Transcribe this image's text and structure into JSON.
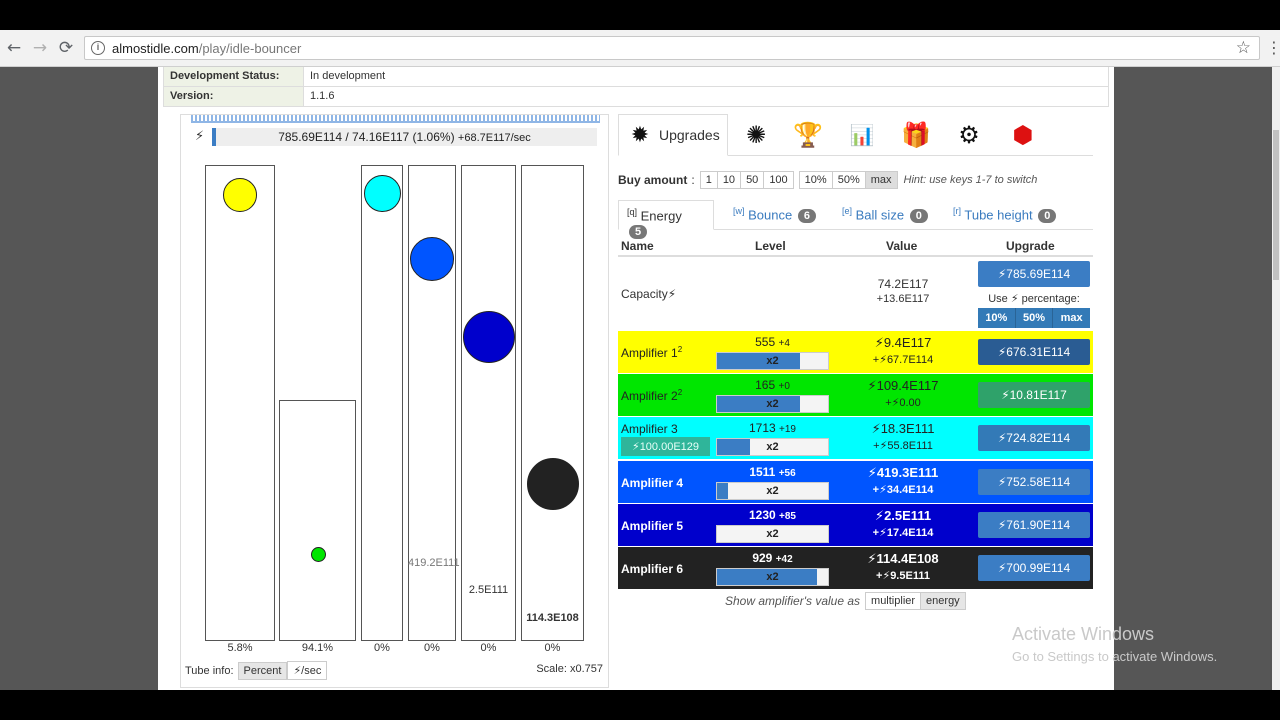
{
  "browser": {
    "url_host": "almostidle.com",
    "url_path": "/play/idle-bouncer",
    "back_icon": "←",
    "forward_icon": "→",
    "reload_icon": "⟳",
    "star_icon": "☆",
    "menu_icon": "⋮"
  },
  "info": {
    "rows": [
      {
        "key": "Development Status:",
        "value": "In development"
      },
      {
        "key": "Version:",
        "value": "1.1.6"
      }
    ]
  },
  "game": {
    "energy_text": "785.69E114 / 74.16E117 (1.06%)",
    "energy_rate": "+68.7E117/sec",
    "energy_fill_percent": 1.06,
    "tubes": [
      {
        "percent_label": "5.8%",
        "value_label": "",
        "ball_color": "#ffff00"
      },
      {
        "percent_label": "94.1%",
        "value_label": "",
        "ball_color": "#00e600"
      },
      {
        "percent_label": "0%",
        "value_label": "",
        "ball_color": "#00ffff"
      },
      {
        "percent_label": "0%",
        "value_label": "419.2E111",
        "ball_color": "#0055ff"
      },
      {
        "percent_label": "0%",
        "value_label": "2.5E111",
        "ball_color": "#0000cc"
      },
      {
        "percent_label": "0%",
        "value_label": "114.3E108",
        "ball_color": "#222222"
      }
    ],
    "tube_info_label": "Tube info:",
    "tube_info_percent": "Percent",
    "tube_info_persec": "/sec",
    "scale": "Scale: x0.757"
  },
  "right": {
    "upgrades_tab": "Upgrades",
    "icons": [
      "upgrades-icon",
      "bounce-icon",
      "trophy-icon",
      "stats-icon",
      "gift-icon",
      "settings-icon",
      "gem-icon"
    ],
    "buy_amount_label": "Buy amount",
    "buy_options": [
      "1",
      "10",
      "50",
      "100"
    ],
    "buy_percent_options": [
      "10%",
      "50%",
      "max"
    ],
    "hint": "Hint: use keys 1-7 to switch",
    "subtabs": [
      {
        "key": "[q]",
        "label": "Energy",
        "count": "5"
      },
      {
        "key": "[w]",
        "label": "Bounce",
        "count": "6"
      },
      {
        "key": "[e]",
        "label": "Ball size",
        "count": "0"
      },
      {
        "key": "[r]",
        "label": "Tube height",
        "count": "0"
      }
    ],
    "headers": {
      "name": "Name",
      "level": "Level",
      "value": "Value",
      "upgrade": "Upgrade"
    },
    "capacity": {
      "name": "Capacity",
      "value": "74.2E117",
      "value_delta": "+13.6E117",
      "upgrade": "785.69E114",
      "use_label": "Use",
      "percentage_label": "percentage:",
      "pct_buttons": [
        "10%",
        "50%",
        "max"
      ]
    },
    "amplifiers": [
      {
        "name": "Amplifier 1",
        "sup": "2",
        "level": "555",
        "level_plus": "+4",
        "mult": "x2",
        "fill": 0.75,
        "value": "9.4E117",
        "delta": "67.7E114",
        "upgrade": "676.31E114",
        "bg": "#ffff00",
        "fg": "#222222",
        "btn": "#2a5c93",
        "extra_btn": ""
      },
      {
        "name": "Amplifier 2",
        "sup": "2",
        "level": "165",
        "level_plus": "+0",
        "mult": "x2",
        "fill": 0.75,
        "value": "109.4E117",
        "delta": "0.00",
        "upgrade": "10.81E117",
        "bg": "#00e600",
        "fg": "#222222",
        "btn": "#2fa26a",
        "extra_btn": ""
      },
      {
        "name": "Amplifier 3",
        "sup": "",
        "level": "1713",
        "level_plus": "+19",
        "mult": "x2",
        "fill": 0.3,
        "value": "18.3E111",
        "delta": "55.8E111",
        "upgrade": "724.82E114",
        "bg": "#00ffff",
        "fg": "#222222",
        "btn": "#337ab7",
        "extra_btn": "100.00E129"
      },
      {
        "name": "Amplifier 4",
        "sup": "",
        "level": "1511",
        "level_plus": "+56",
        "mult": "x2",
        "fill": 0.1,
        "value": "419.3E111",
        "delta": "34.4E114",
        "upgrade": "752.58E114",
        "bg": "#0055ff",
        "fg": "#ffffff",
        "btn": "#3b7dc4",
        "extra_btn": ""
      },
      {
        "name": "Amplifier 5",
        "sup": "",
        "level": "1230",
        "level_plus": "+85",
        "mult": "x2",
        "fill": 0.0,
        "value": "2.5E111",
        "delta": "17.4E114",
        "upgrade": "761.90E114",
        "bg": "#0000cc",
        "fg": "#ffffff",
        "btn": "#3b7dc4",
        "extra_btn": ""
      },
      {
        "name": "Amplifier 6",
        "sup": "",
        "level": "929",
        "level_plus": "+42",
        "mult": "x2",
        "fill": 0.9,
        "value": "114.4E108",
        "delta": "9.5E111",
        "upgrade": "700.99E114",
        "bg": "#222222",
        "fg": "#ffffff",
        "btn": "#3b7dc4",
        "extra_btn": ""
      }
    ],
    "show_label": "Show amplifier's value as",
    "show_multiplier": "multiplier",
    "show_energy": "energy"
  },
  "watermark": {
    "line1": "Activate Windows",
    "line2": "Go to Settings to activate Windows."
  }
}
